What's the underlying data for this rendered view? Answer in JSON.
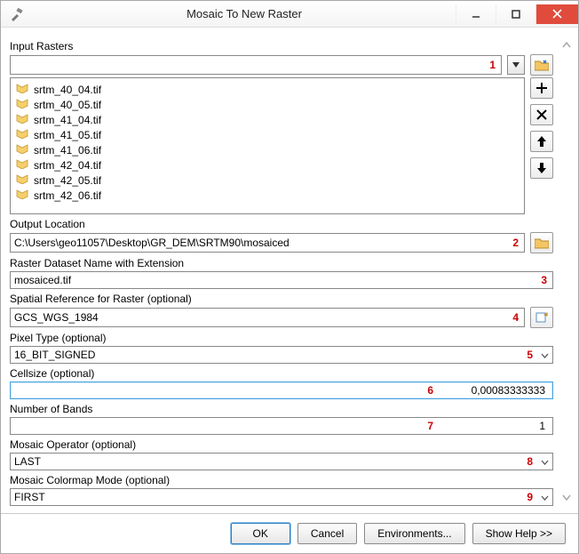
{
  "window": {
    "title": "Mosaic To New Raster"
  },
  "labels": {
    "input_rasters": "Input Rasters",
    "output_location": "Output Location",
    "raster_name": "Raster Dataset Name with Extension",
    "spatial_ref": "Spatial Reference for Raster (optional)",
    "pixel_type": "Pixel Type (optional)",
    "cellsize": "Cellsize (optional)",
    "num_bands": "Number of Bands",
    "mosaic_op": "Mosaic Operator (optional)",
    "colormap": "Mosaic Colormap Mode (optional)"
  },
  "markers": {
    "m1": "1",
    "m2": "2",
    "m3": "3",
    "m4": "4",
    "m5": "5",
    "m6": "6",
    "m7": "7",
    "m8": "8",
    "m9": "9"
  },
  "values": {
    "input_path": "",
    "output_location": "C:\\Users\\geo11057\\Desktop\\GR_DEM\\SRTM90\\mosaiced",
    "raster_name": "mosaiced.tif",
    "spatial_ref": "GCS_WGS_1984",
    "pixel_type": "16_BIT_SIGNED",
    "cellsize": "0,00083333333",
    "num_bands": "1",
    "mosaic_op": "LAST",
    "colormap": "FIRST"
  },
  "raster_list": [
    "srtm_40_04.tif",
    "srtm_40_05.tif",
    "srtm_41_04.tif",
    "srtm_41_05.tif",
    "srtm_41_06.tif",
    "srtm_42_04.tif",
    "srtm_42_05.tif",
    "srtm_42_06.tif"
  ],
  "footer": {
    "ok": "OK",
    "cancel": "Cancel",
    "env": "Environments...",
    "help": "Show Help >>"
  }
}
